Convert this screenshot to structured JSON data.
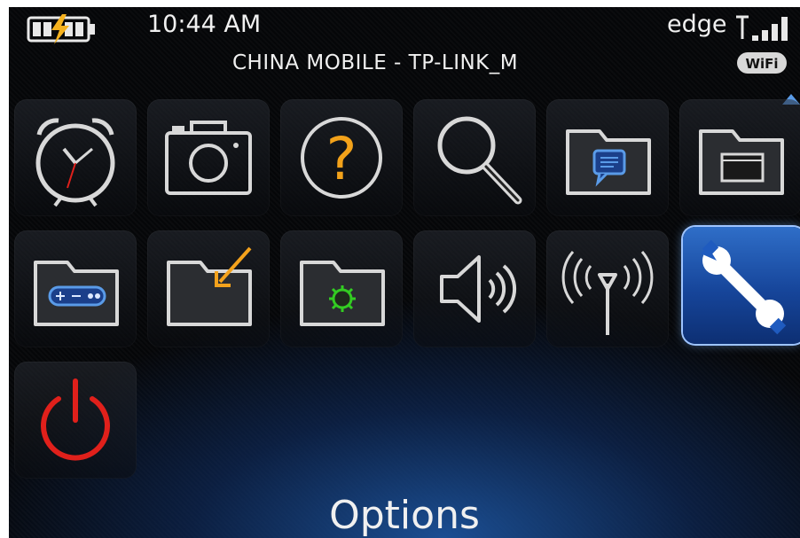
{
  "status_bar": {
    "time": "10:44 AM",
    "network_type": "edge",
    "carrier": "CHINA  MOBILE - TP-LINK_M",
    "wifi_badge": "WiFi",
    "battery_icon": "battery-charging-icon",
    "signal_icon": "signal-strength-icon"
  },
  "grid": {
    "selected_index": 11,
    "icons": [
      "alarm-clock-icon",
      "camera-icon",
      "help-icon",
      "search-icon",
      "messenger-folder-icon",
      "applications-folder-icon",
      "games-folder-icon",
      "downloads-folder-icon",
      "settings-folder-icon",
      "sounds-icon",
      "manage-connections-icon",
      "options-icon",
      "power-icon"
    ]
  },
  "footer": {
    "selected_label": "Options"
  },
  "colors": {
    "selection": "#1f5bbf",
    "power": "#e0201b",
    "help": "#f3a21a",
    "folder_green_gear": "#33cc22",
    "folder_arrow": "#f4a21c",
    "folder_blue": "#2e6fd8"
  }
}
